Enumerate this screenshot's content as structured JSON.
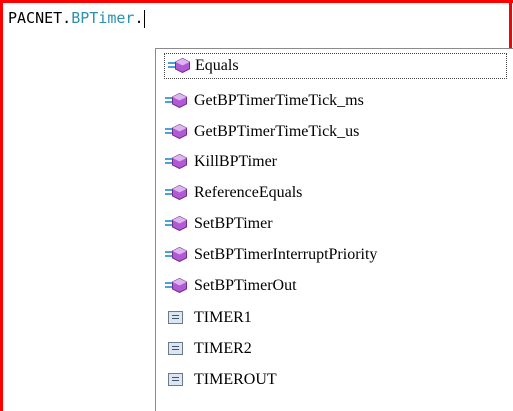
{
  "editor": {
    "code_prefix": "PACNET.",
    "code_class": "BPTimer",
    "code_suffix": "."
  },
  "completion": {
    "items": [
      {
        "label": "Equals",
        "icon": "method-icon",
        "selected": true
      },
      {
        "label": "GetBPTimerTimeTick_ms",
        "icon": "method-icon"
      },
      {
        "label": "GetBPTimerTimeTick_us",
        "icon": "method-icon"
      },
      {
        "label": "KillBPTimer",
        "icon": "method-icon"
      },
      {
        "label": "ReferenceEquals",
        "icon": "method-icon"
      },
      {
        "label": "SetBPTimer",
        "icon": "method-icon"
      },
      {
        "label": "SetBPTimerInterruptPriority",
        "icon": "method-icon"
      },
      {
        "label": "SetBPTimerOut",
        "icon": "method-icon"
      },
      {
        "label": "TIMER1",
        "icon": "field-icon"
      },
      {
        "label": "TIMER2",
        "icon": "field-icon"
      },
      {
        "label": "TIMEROUT",
        "icon": "field-icon"
      }
    ]
  },
  "colors": {
    "frame": "#ff0000",
    "class_name": "#2b91af",
    "method_icon": "#b259d6"
  }
}
